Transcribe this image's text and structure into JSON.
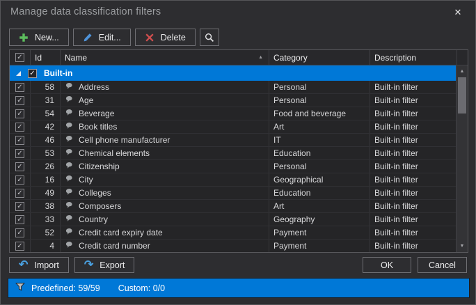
{
  "window": {
    "title": "Manage data classification filters",
    "close_glyph": "✕"
  },
  "toolbar": {
    "new_label": "New...",
    "edit_label": "Edit...",
    "delete_label": "Delete"
  },
  "grid": {
    "columns": {
      "id": "Id",
      "name": "Name",
      "category": "Category",
      "description": "Description"
    },
    "group_label": "Built-in",
    "group_checked": true,
    "rows": [
      {
        "id": "58",
        "name": "Address",
        "category": "Personal",
        "description": "Built-in filter",
        "checked": true
      },
      {
        "id": "31",
        "name": "Age",
        "category": "Personal",
        "description": "Built-in filter",
        "checked": true
      },
      {
        "id": "54",
        "name": "Beverage",
        "category": "Food and beverage",
        "description": "Built-in filter",
        "checked": true
      },
      {
        "id": "42",
        "name": "Book titles",
        "category": "Art",
        "description": "Built-in filter",
        "checked": true
      },
      {
        "id": "46",
        "name": "Cell phone manufacturer",
        "category": "IT",
        "description": "Built-in filter",
        "checked": true
      },
      {
        "id": "53",
        "name": "Chemical elements",
        "category": "Education",
        "description": "Built-in filter",
        "checked": true
      },
      {
        "id": "26",
        "name": "Citizenship",
        "category": "Personal",
        "description": "Built-in filter",
        "checked": true
      },
      {
        "id": "16",
        "name": "City",
        "category": "Geographical",
        "description": "Built-in filter",
        "checked": true
      },
      {
        "id": "49",
        "name": "Colleges",
        "category": "Education",
        "description": "Built-in filter",
        "checked": true
      },
      {
        "id": "38",
        "name": "Composers",
        "category": "Art",
        "description": "Built-in filter",
        "checked": true
      },
      {
        "id": "33",
        "name": "Country",
        "category": "Geography",
        "description": "Built-in filter",
        "checked": true
      },
      {
        "id": "52",
        "name": "Credit card expiry date",
        "category": "Payment",
        "description": "Built-in filter",
        "checked": true
      },
      {
        "id": "4",
        "name": "Credit card number",
        "category": "Payment",
        "description": "Built-in filter",
        "checked": true
      }
    ]
  },
  "footer": {
    "import_label": "Import",
    "export_label": "Export",
    "ok_label": "OK",
    "cancel_label": "Cancel"
  },
  "status": {
    "predefined_label": "Predefined: 59/59",
    "custom_label": "Custom: 0/0"
  },
  "icons": {
    "check": "✓",
    "sort_asc": "▲",
    "scroll_up": "▲",
    "scroll_down": "▼",
    "import_arrow": "↶",
    "export_arrow": "↷"
  },
  "colors": {
    "accent_blue": "#0078d7",
    "new_icon_green": "#5dbd5d",
    "edit_icon_blue": "#4f93d9",
    "delete_icon_red": "#cf4e4e",
    "import_export_arrow_blue": "#4aa0e0"
  }
}
